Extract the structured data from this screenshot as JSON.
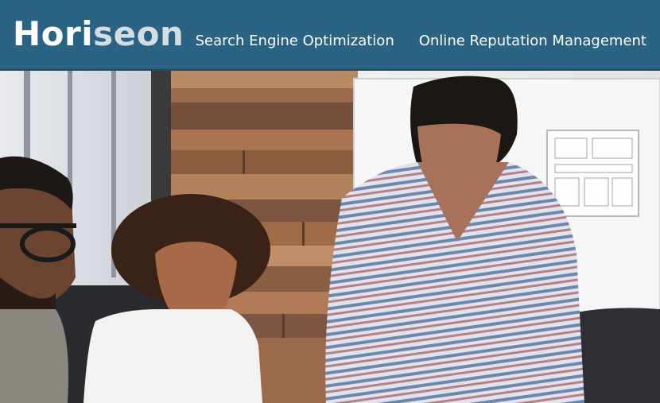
{
  "header": {
    "logo_part1": "Hori",
    "logo_part2": "seon",
    "nav": [
      {
        "label": "Search Engine Optimization"
      },
      {
        "label": "Online Reputation Management"
      }
    ]
  },
  "hero": {
    "image_description": "three-people-working-at-table"
  },
  "colors": {
    "header_bg": "#2a6383",
    "logo_accent": "#d5dde3",
    "nav_text": "#ffffff"
  }
}
